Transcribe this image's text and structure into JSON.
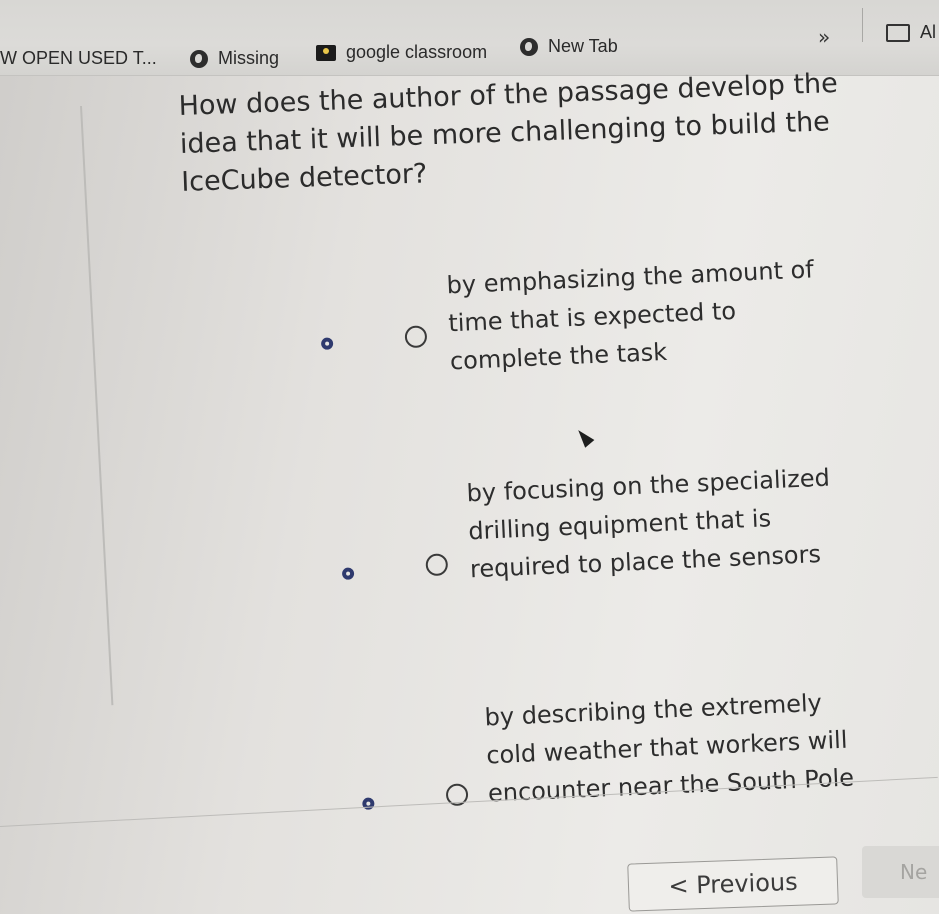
{
  "bookmarks": [
    {
      "label": "W OPEN USED T...",
      "icon": "none"
    },
    {
      "label": "Missing",
      "icon": "globe-icon"
    },
    {
      "label": "google classroom",
      "icon": "classroom-icon"
    },
    {
      "label": "New Tab",
      "icon": "globe-icon"
    }
  ],
  "bookmarks_overflow": "»",
  "all_bookmarks_label": "Al",
  "question": "How does the author of the passage develop the idea that it will be more challenging to build the IceCube detector?",
  "options": [
    {
      "text": "by emphasizing the amount of time that is expected to complete the task"
    },
    {
      "text": "by focusing on the specialized drilling equipment that is required to place the sensors"
    },
    {
      "text": "by describing the extremely cold weather that workers will encounter near the South Pole"
    }
  ],
  "nav": {
    "previous": "< Previous",
    "next": "Ne"
  },
  "colors": {
    "radio_dot": "#2f3a6e",
    "text": "#2d2d2d"
  }
}
